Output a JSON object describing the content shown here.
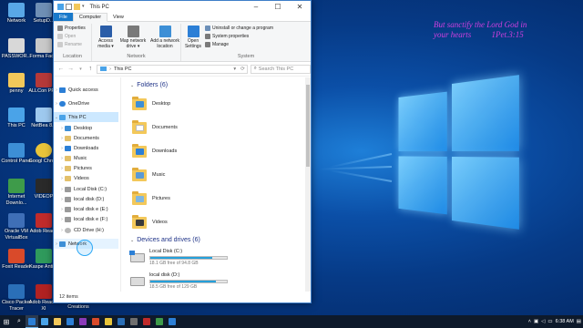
{
  "desktop": {
    "verse_line1": "But sanctify the Lord God in",
    "verse_line2": "your hearts",
    "verse_ref": "1Pet.3:15",
    "icons": [
      {
        "label": "Network",
        "color": "#59a7e6"
      },
      {
        "label": "SetupD...",
        "color": "#6f8fb5"
      },
      {
        "label": "PASSWOR...",
        "color": "#d8d8d8"
      },
      {
        "label": "Forma Facto",
        "color": "#c9c9c9"
      },
      {
        "label": "penny",
        "color": "#f3c85a"
      },
      {
        "label": "ALLCon PRO",
        "color": "#b53939"
      },
      {
        "label": "This PC",
        "color": "#4aa3e8"
      },
      {
        "label": "NetBea 8.2",
        "color": "#9ec9ef"
      },
      {
        "label": "Control Panel",
        "color": "#3d8fd6"
      },
      {
        "label": "Googl Chrom",
        "color": "#e8c43a"
      },
      {
        "label": "Internet Downlo...",
        "color": "#3e9b4a"
      },
      {
        "label": "VIDEOP",
        "color": "#2a2a2a"
      },
      {
        "label": "Oracle VM VirtualBox",
        "color": "#3f6fb7"
      },
      {
        "label": "Adob Reade",
        "color": "#c02b2b"
      },
      {
        "label": "Foxit Reader",
        "color": "#d94a2a"
      },
      {
        "label": "Kaspe Anti-V",
        "color": "#2f9a5c"
      },
      {
        "label": "Cisco Packet Tracer",
        "color": "#2a6fb8"
      },
      {
        "label": "Adob Reader XI",
        "color": "#b12222"
      },
      {
        "label": "Creations",
        "color": "#f3c85a"
      }
    ]
  },
  "window": {
    "title": "This PC",
    "tabs": [
      "File",
      "Computer",
      "View"
    ],
    "ribbon": {
      "location": {
        "label": "Location",
        "properties": "Properties",
        "open": "Open",
        "rename": "Rename"
      },
      "network": {
        "label": "Network",
        "access_media": [
          "Access",
          "media ▾"
        ],
        "map_drive": [
          "Map network",
          "drive ▾"
        ],
        "add_location": [
          "Add a network",
          "location"
        ]
      },
      "system": {
        "label": "System",
        "open_settings": [
          "Open",
          "Settings"
        ],
        "uninstall": "Uninstall or change a program",
        "system_properties": "System properties",
        "manage": "Manage"
      }
    },
    "address": {
      "path": "This PC",
      "search_placeholder": "Search This PC"
    },
    "nav": [
      {
        "label": "Quick access",
        "icon": "star-icon",
        "color": "#2c7fd6"
      },
      {
        "label": "OneDrive",
        "icon": "cloud-icon",
        "color": "#2c7fd6"
      },
      {
        "label": "This PC",
        "icon": "computer-icon",
        "color": "#4aa3e8"
      },
      {
        "label": "Desktop",
        "icon": "desktop-folder-icon",
        "color": "#3d8fd6"
      },
      {
        "label": "Documents",
        "icon": "documents-folder-icon",
        "color": "#e3c06a"
      },
      {
        "label": "Downloads",
        "icon": "downloads-folder-icon",
        "color": "#2c7fd6"
      },
      {
        "label": "Music",
        "icon": "music-folder-icon",
        "color": "#e3c06a"
      },
      {
        "label": "Pictures",
        "icon": "pictures-folder-icon",
        "color": "#e3c06a"
      },
      {
        "label": "Videos",
        "icon": "videos-folder-icon",
        "color": "#e3c06a"
      },
      {
        "label": "Local Disk (C:)",
        "icon": "drive-icon",
        "color": "#9a9a9a"
      },
      {
        "label": "local disk (D:)",
        "icon": "drive-icon",
        "color": "#9a9a9a"
      },
      {
        "label": "local disk e (E:)",
        "icon": "drive-icon",
        "color": "#9a9a9a"
      },
      {
        "label": "local disk e (F:)",
        "icon": "drive-icon",
        "color": "#9a9a9a"
      },
      {
        "label": "CD Drive (H:)",
        "icon": "cd-drive-icon",
        "color": "#b8b8b8"
      },
      {
        "label": "Network",
        "icon": "network-icon",
        "color": "#3d8fd6"
      }
    ],
    "folders_header": "Folders (6)",
    "folders": [
      {
        "label": "Desktop",
        "overlay": "#3d8fd6"
      },
      {
        "label": "Documents",
        "overlay": "#ffffff"
      },
      {
        "label": "Downloads",
        "overlay": "#2c7fd6"
      },
      {
        "label": "Music",
        "overlay": "#5a9ad6"
      },
      {
        "label": "Pictures",
        "overlay": "#7fb6e0"
      },
      {
        "label": "Videos",
        "overlay": "#3a3a3a"
      }
    ],
    "drives_header": "Devices and drives (6)",
    "drives": [
      {
        "label": "Local Disk (C:)",
        "free": "18.1 GB free of 94.8 GB",
        "used_fraction": 0.81
      },
      {
        "label": "local disk (D:)",
        "free": "18.5 GB free of 129 GB",
        "used_fraction": 0.86
      }
    ],
    "status": "12 items"
  },
  "taskbar": {
    "time": "6:38 AM",
    "apps": [
      "#2c7fd6",
      "#4aa3e8",
      "#f3c85a",
      "#2c7fd6",
      "#8a3ab9",
      "#d94a2a",
      "#e8c43a",
      "#2a6fb8",
      "#6f6f6f",
      "#c02b2b",
      "#3e9b4a",
      "#2c7fd6"
    ]
  }
}
